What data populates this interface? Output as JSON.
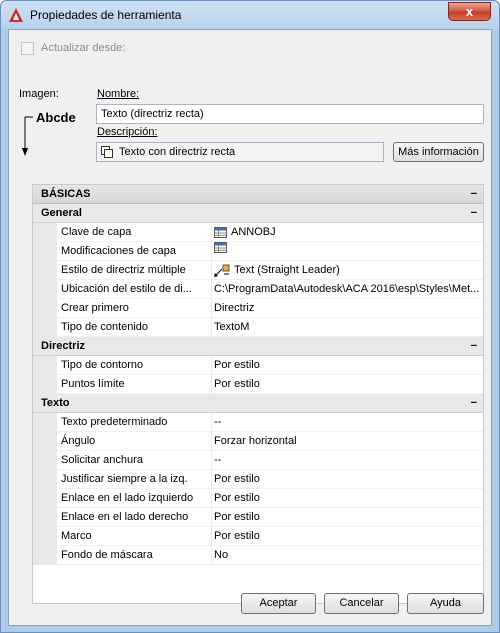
{
  "window": {
    "title": "Propiedades de herramienta",
    "close_glyph": "x"
  },
  "top": {
    "actualizar_label": "Actualizar desde:",
    "imagen_label": "Imagen:",
    "nombre_label": "Nombre:",
    "nombre_value": "Texto (directriz recta)",
    "descripcion_label": "Descripción:",
    "descripcion_value": "Texto con directriz recta",
    "mas_info_label": "Más información",
    "preview_text": "Abcde"
  },
  "grid": {
    "basicas": {
      "label": "BÁSICAS",
      "toggle": "−"
    },
    "general": {
      "label": "General",
      "toggle": "−",
      "rows": [
        {
          "name": "Clave de capa",
          "value": "ANNOBJ",
          "icon": "layer-key-icon"
        },
        {
          "name": "Modificaciones de capa",
          "value": "",
          "icon": "layer-overrides-icon"
        },
        {
          "name": "Estilo de directriz múltiple",
          "value": "Text (Straight Leader)",
          "icon": "mleader-style-icon"
        },
        {
          "name": "Ubicación del estilo de di...",
          "value": "C:\\ProgramData\\Autodesk\\ACA 2016\\esp\\Styles\\Met..."
        },
        {
          "name": "Crear primero",
          "value": "Directriz"
        },
        {
          "name": "Tipo de contenido",
          "value": "TextoM"
        }
      ]
    },
    "directriz": {
      "label": "Directriz",
      "toggle": "−",
      "rows": [
        {
          "name": "Tipo de contorno",
          "value": "Por estilo"
        },
        {
          "name": "Puntos límite",
          "value": "Por estilo"
        }
      ]
    },
    "texto": {
      "label": "Texto",
      "toggle": "−",
      "rows": [
        {
          "name": "Texto predeterminado",
          "value": "--"
        },
        {
          "name": "Ángulo",
          "value": "Forzar horizontal"
        },
        {
          "name": "Solicitar anchura",
          "value": "--"
        },
        {
          "name": "Justificar siempre a la izq.",
          "value": "Por estilo"
        },
        {
          "name": "Enlace en el lado izquierdo",
          "value": "Por estilo"
        },
        {
          "name": "Enlace en el lado derecho",
          "value": "Por estilo"
        },
        {
          "name": "Marco",
          "value": "Por estilo"
        },
        {
          "name": "Fondo de máscara",
          "value": "No"
        }
      ]
    }
  },
  "buttons": {
    "aceptar": "Aceptar",
    "cancelar": "Cancelar",
    "ayuda": "Ayuda"
  },
  "colors": {
    "accent": "#c33b24",
    "title_bar": "#b9d1ec",
    "section_bg": "#d7d7d7"
  }
}
